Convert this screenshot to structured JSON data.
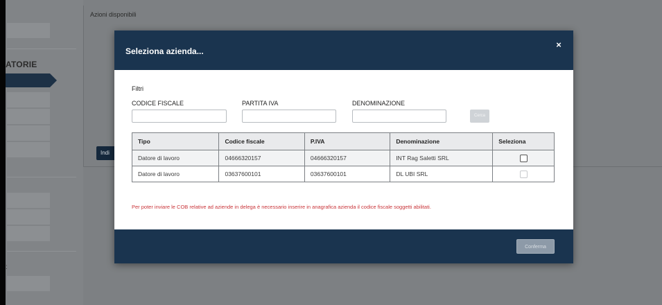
{
  "background": {
    "sidebar_title": "ATORIE",
    "sidebar_small": ":",
    "main_title": "Azioni disponibili",
    "main_button_label": "Indi"
  },
  "modal": {
    "title": "Seleziona azienda...",
    "close_icon": "×",
    "filters_label": "Filtri",
    "fields": {
      "codice_fiscale": {
        "label": "CODICE FISCALE",
        "value": "",
        "placeholder": ""
      },
      "partita_iva": {
        "label": "PARTITA IVA",
        "value": "",
        "placeholder": ""
      },
      "denominazione": {
        "label": "DENOMINAZIONE",
        "value": "",
        "placeholder": ""
      }
    },
    "search_label": "Cerca",
    "table": {
      "headers": [
        "Tipo",
        "Codice fiscale",
        "P.IVA",
        "Denominazione",
        "Seleziona"
      ],
      "rows": [
        {
          "tipo": "Datore di lavoro",
          "codice_fiscale": "04666320157",
          "piva": "04666320157",
          "denominazione": "INT Rag Saletti SRL",
          "selectable": true
        },
        {
          "tipo": "Datore di lavoro",
          "codice_fiscale": "03637600101",
          "piva": "03637600101",
          "denominazione": "DL UBI SRL",
          "selectable": false
        }
      ]
    },
    "note": "Per poter inviare le COB relative ad aziende in delega è necessario inserire in anagrafica azienda il codice fiscale soggetti abilitati.",
    "confirm_label": "Conferma"
  },
  "colors": {
    "header": "#1a344f",
    "note": "#c9353a"
  }
}
